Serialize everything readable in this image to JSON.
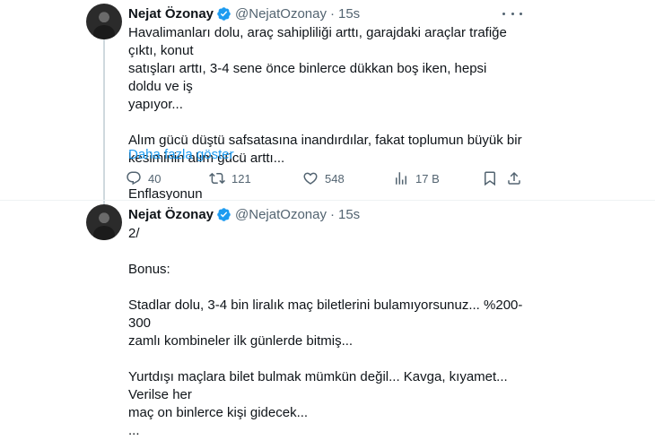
{
  "colors": {
    "text": "#0f1419",
    "muted": "#536471",
    "link": "#1d9bf0",
    "verified": "#1d9bf0"
  },
  "tweets": [
    {
      "name": "Nejat Özonay",
      "handle": "@NejatOzonay",
      "dot": "·",
      "time": "15s",
      "text": "Havalimanları dolu, araç sahipliliği arttı, garajdaki araçlar trafiğe çıktı, konut\nsatışları arttı, 3-4 sene önce binlerce dükkan boş iken, hepsi doldu ve iş\nyapıyor...\n\nAlım gücü düştü safsatasına inandırdılar, fakat toplumun büyük bir\nkesiminin alım gücü arttı...\n\nEnflasyonun",
      "show_more": "Daha fazla göster",
      "replies": "40",
      "retweets": "121",
      "likes": "548",
      "views": "17 B",
      "icons": [
        "verified-badge-icon",
        "more-icon",
        "reply-icon",
        "retweet-icon",
        "like-icon",
        "views-icon",
        "bookmark-icon",
        "share-icon"
      ]
    },
    {
      "name": "Nejat Özonay",
      "handle": "@NejatOzonay",
      "dot": "·",
      "time": "15s",
      "text": "2/\n\nBonus:\n\nStadlar dolu, 3-4 bin liralık maç biletlerini bulamıyorsunuz... %200-300\nzamlı kombineler ilk günlerde bitmiş...\n\nYurtdışı maçlara bilet bulmak mümkün değil... Kavga, kıyamet... Verilse her\nmaç on binlerce kişi gidecek...\n..."
    }
  ]
}
